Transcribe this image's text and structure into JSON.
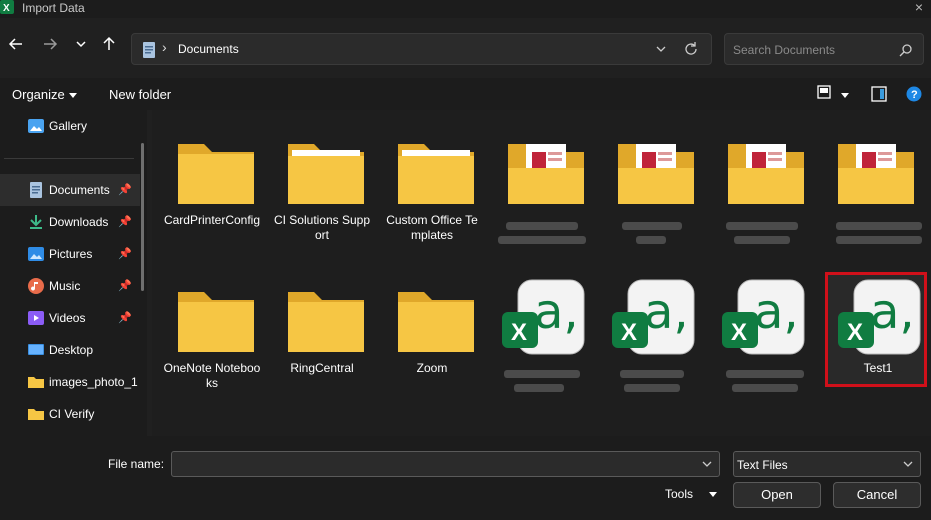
{
  "window": {
    "title": "Import Data",
    "close_glyph": "×"
  },
  "address": {
    "location": "Documents"
  },
  "search": {
    "placeholder": "Search Documents"
  },
  "toolbar": {
    "organize_label": "Organize",
    "new_folder_label": "New folder"
  },
  "sidebar": {
    "items": [
      {
        "label": "Gallery",
        "icon": "gallery-icon",
        "pinned": false
      },
      {
        "label": "Documents",
        "icon": "documents-icon",
        "pinned": true,
        "active": true
      },
      {
        "label": "Downloads",
        "icon": "downloads-icon",
        "pinned": true
      },
      {
        "label": "Pictures",
        "icon": "pictures-icon",
        "pinned": true
      },
      {
        "label": "Music",
        "icon": "music-icon",
        "pinned": true
      },
      {
        "label": "Videos",
        "icon": "videos-icon",
        "pinned": true
      },
      {
        "label": "Desktop",
        "icon": "desktop-icon",
        "pinned": false
      },
      {
        "label": "images_photo_1",
        "icon": "folder-icon",
        "pinned": false
      },
      {
        "label": "CI Verify",
        "icon": "folder-icon",
        "pinned": false
      }
    ]
  },
  "files": [
    {
      "label": "CardPrinterConfig",
      "type": "folder"
    },
    {
      "label": "CI Solutions Support",
      "type": "folder"
    },
    {
      "label": "Custom Office Templates",
      "type": "folder"
    },
    {
      "label": "",
      "type": "access-folder"
    },
    {
      "label": "",
      "type": "access-folder"
    },
    {
      "label": "",
      "type": "access-folder"
    },
    {
      "label": "",
      "type": "access-folder"
    },
    {
      "label": "OneNote Notebooks",
      "type": "folder"
    },
    {
      "label": "RingCentral",
      "type": "folder"
    },
    {
      "label": "Zoom",
      "type": "folder"
    },
    {
      "label": "",
      "type": "excel-text"
    },
    {
      "label": "",
      "type": "excel-text"
    },
    {
      "label": "",
      "type": "excel-text"
    },
    {
      "label": "Test1",
      "type": "excel-text",
      "selected": true
    }
  ],
  "bottom": {
    "file_name_label": "File name:",
    "file_name_value": "",
    "file_type": "Text Files",
    "tools_label": "Tools",
    "open_label": "Open",
    "cancel_label": "Cancel"
  },
  "colors": {
    "accent": "#d0101a",
    "folder": "#f6c644",
    "excel": "#107c41"
  }
}
